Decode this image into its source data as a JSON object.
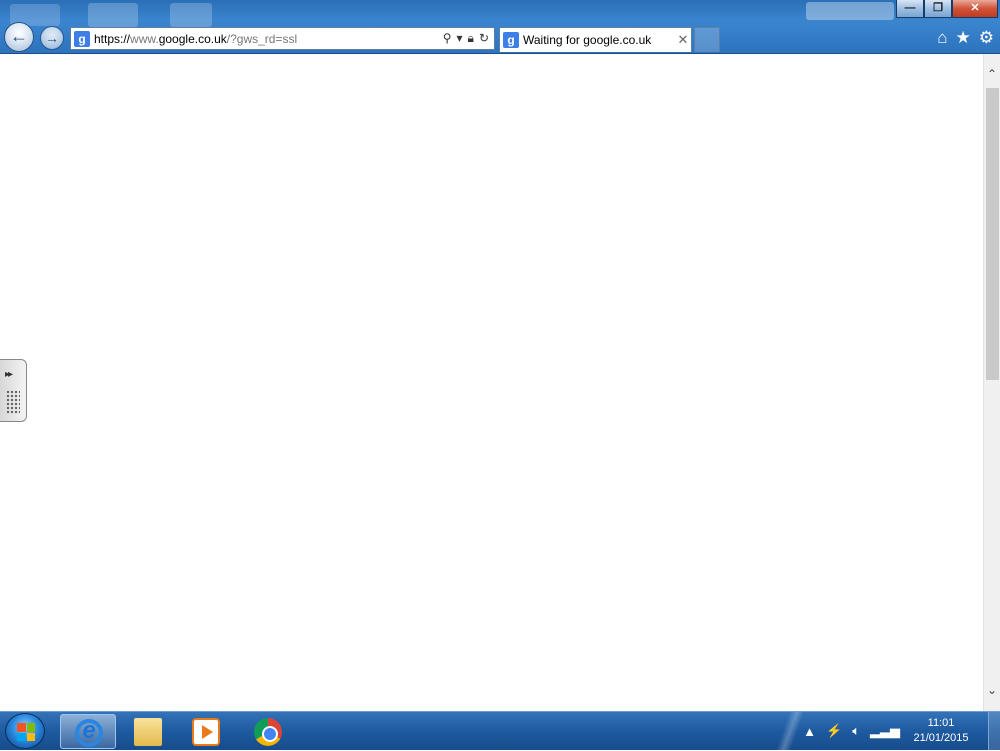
{
  "browser": {
    "address": {
      "scheme": "https://",
      "prefix": "www.",
      "domain": "google.co.uk",
      "path": "/?gws_rd=ssl"
    },
    "tab": {
      "favicon_letter": "g",
      "title": "Waiting for google.co.uk",
      "close_glyph": "✕"
    },
    "window_controls": {
      "minimize": "—",
      "restore": "❐",
      "close": "✕"
    },
    "icons": [
      "back-icon",
      "forward-icon",
      "search-icon",
      "dropdown-icon",
      "lock-icon",
      "refresh-icon",
      "home-icon",
      "favorites-star-icon",
      "tools-gear-icon"
    ]
  },
  "taskbar": {
    "items": [
      "internet-explorer",
      "windows-explorer",
      "media-player",
      "google-chrome"
    ],
    "active_item": "internet-explorer",
    "clock": {
      "time": "11:01",
      "date": "21/01/2015"
    }
  },
  "colors": {
    "frame": "#2d73bd",
    "taskbar": "#1e5aa0",
    "accent": "#3d7fe6"
  }
}
